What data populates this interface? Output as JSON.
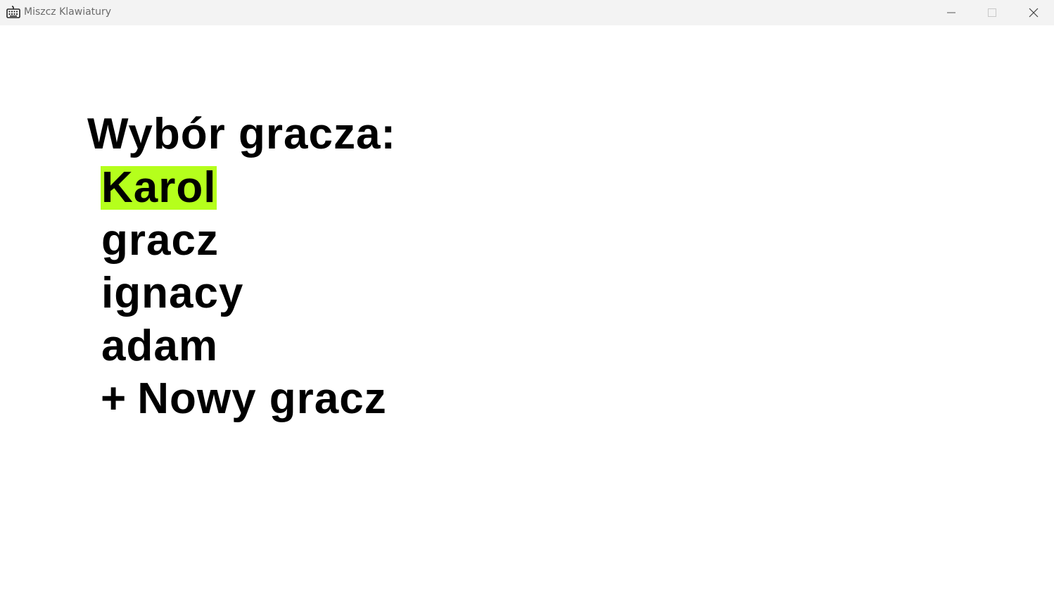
{
  "window": {
    "title": "Miszcz Klawiatury",
    "icon": "keyboard-icon",
    "controls": {
      "minimize": "minimize-icon",
      "maximize": "maximize-icon",
      "close": "close-icon"
    }
  },
  "screen": {
    "heading": "Wybór gracza:",
    "players": [
      {
        "name": "Karol",
        "selected": true
      },
      {
        "name": "gracz",
        "selected": false
      },
      {
        "name": "ignacy",
        "selected": false
      },
      {
        "name": "adam",
        "selected": false
      }
    ],
    "add_player": {
      "plus": "+",
      "label": "Nowy gracz"
    }
  },
  "colors": {
    "highlight": "#b5ff1c",
    "text": "#000000",
    "titlebar": "#f3f3f3",
    "background": "#ffffff"
  }
}
